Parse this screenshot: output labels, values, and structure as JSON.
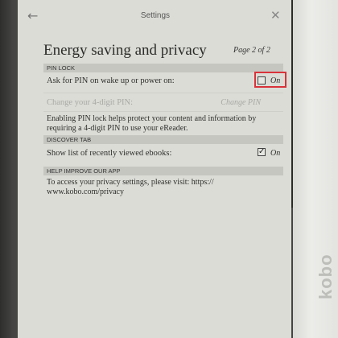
{
  "topbar": {
    "title": "Settings",
    "back_icon": "arrow-left-icon",
    "close_icon": "close-icon"
  },
  "header": {
    "title": "Energy saving and privacy",
    "page_indicator": "Page 2 of 2"
  },
  "pin_lock": {
    "section_label": "PIN LOCK",
    "ask_pin_label": "Ask for PIN on wake up or power on:",
    "ask_pin_checked": false,
    "ask_pin_on_label": "On",
    "change_pin_label": "Change your 4-digit PIN:",
    "change_pin_link": "Change PIN",
    "description_line1": "Enabling PIN lock helps protect your content and information by",
    "description_line2": "requiring a 4-digit PIN to use your eReader."
  },
  "discover_tab": {
    "section_label": "DISCOVER TAB",
    "show_recent_label": "Show list of recently viewed ebooks:",
    "show_recent_checked": true,
    "show_recent_on_label": "On"
  },
  "help_improve": {
    "section_label": "HELP IMPROVE OUR APP",
    "privacy_line1": "To access your privacy settings, please visit: https://",
    "privacy_line2": "www.kobo.com/privacy"
  },
  "device": {
    "brand": "kobo"
  },
  "colors": {
    "highlight": "#d8323a",
    "screen": "#dcdcd7",
    "section": "#c6c6c1"
  }
}
